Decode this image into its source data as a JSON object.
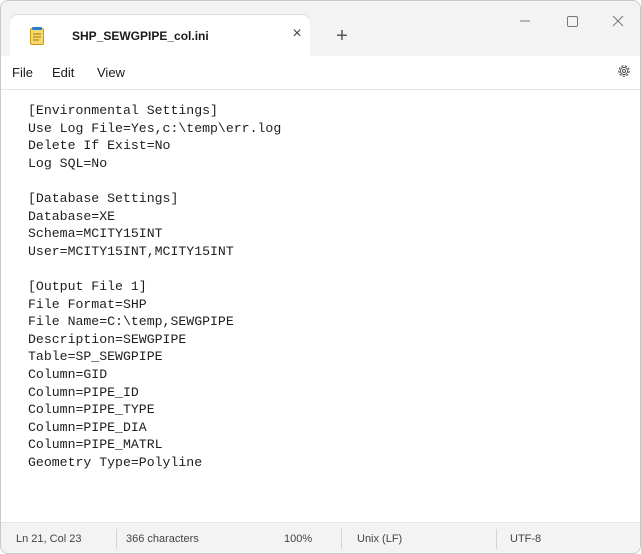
{
  "tab": {
    "title": "SHP_SEWGPIPE_col.ini",
    "close_glyph": "×",
    "new_tab_glyph": "+"
  },
  "window_controls": {
    "minimize": "—",
    "maximize": "☐",
    "close": "✕"
  },
  "menu": {
    "file": "File",
    "edit": "Edit",
    "view": "View"
  },
  "editor": {
    "content": "[Environmental Settings]\nUse Log File=Yes,c:\\temp\\err.log\nDelete If Exist=No\nLog SQL=No\n\n[Database Settings]\nDatabase=XE\nSchema=MCITY15INT\nUser=MCITY15INT,MCITY15INT\n\n[Output File 1]\nFile Format=SHP\nFile Name=C:\\temp,SEWGPIPE\nDescription=SEWGPIPE\nTable=SP_SEWGPIPE\nColumn=GID\nColumn=PIPE_ID\nColumn=PIPE_TYPE\nColumn=PIPE_DIA\nColumn=PIPE_MATRL\nGeometry Type=Polyline"
  },
  "status": {
    "position": "Ln 21, Col 23",
    "characters": "366 characters",
    "zoom": "100%",
    "line_ending": "Unix (LF)",
    "encoding": "UTF-8"
  },
  "icons": {
    "tab": "notepad-file-icon",
    "settings": "gear-icon"
  },
  "colors": {
    "titlebar": "#f3f3f3",
    "statusbar": "#f3f3f3",
    "notepad_icon": "#e8b422"
  }
}
